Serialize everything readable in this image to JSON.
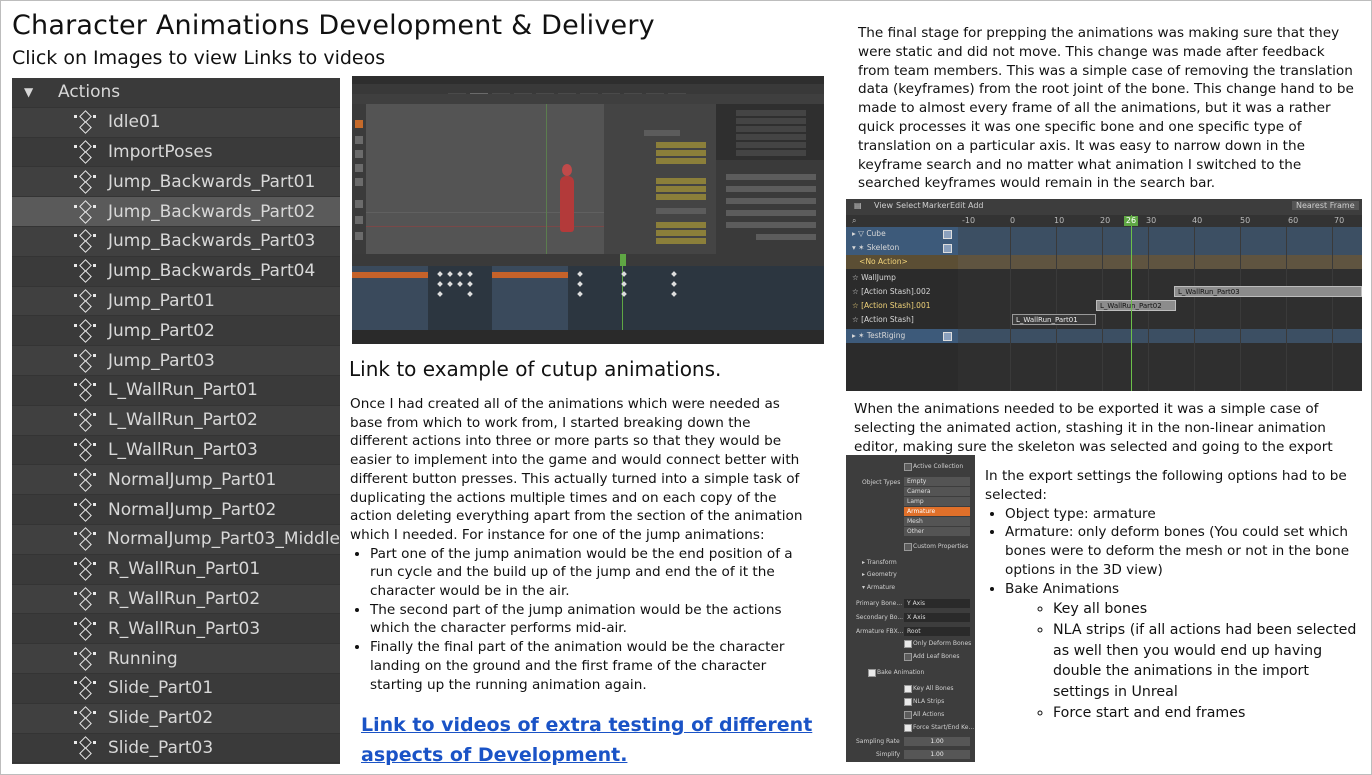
{
  "page": {
    "title": "Character Animations Development & Delivery",
    "subtitle": "Click on Images to view Links to videos"
  },
  "outliner": {
    "header": "Actions",
    "items": [
      "Idle01",
      "ImportPoses",
      "Jump_Backwards_Part01",
      "Jump_Backwards_Part02",
      "Jump_Backwards_Part03",
      "Jump_Backwards_Part04",
      "Jump_Part01",
      "Jump_Part02",
      "Jump_Part03",
      "L_WallRun_Part01",
      "L_WallRun_Part02",
      "L_WallRun_Part03",
      "NormalJump_Part01",
      "NormalJump_Part02",
      "NormalJump_Part03_Middle",
      "R_WallRun_Part01",
      "R_WallRun_Part02",
      "R_WallRun_Part03",
      "Running",
      "Slide_Part01",
      "Slide_Part02",
      "Slide_Part03"
    ],
    "selected_item": "Jump_Backwards_Part02"
  },
  "middle": {
    "cutup_link": "Link to example of cutup animations.",
    "intro": "Once I had created all of the animations which were needed as base from which to work from, I started breaking down the different actions into three or more parts so that they would be easier to implement into the game and would connect better with different button presses. This actually turned into a simple task of  duplicating the actions multiple times and on each copy of the action deleting everything apart from the section of the animation which I needed. For instance for one of the jump animations:",
    "bullets": [
      "Part one of the jump animation would be the end position of a run cycle and the build up of the jump and end the of it the character would be in the air.",
      "The second part of the jump animation would be the actions which the character performs mid-air.",
      "Finally the final part of the animation would be the character landing on the ground and the first frame of the character starting up the running animation again."
    ],
    "extra_link": "Link to videos of extra testing of different aspects of Development."
  },
  "right": {
    "final_stage": "The final stage for prepping the animations was making sure that they were static and did not move. This change was made after feedback from team members. This was a simple case of removing the translation data (keyframes) from the root joint of the bone. This change hand to be made to almost every frame of all the animations, but it was a rather quick processes it was one specific bone and one specific type of translation on a particular axis. It was easy to narrow down in the keyframe search and no matter what animation I switched to the searched keyframes would remain in the search bar.",
    "export_intro": "When the animations needed to be exported it was a simple case of selecting the animated action, stashing it in the non-linear animation editor, making sure the skeleton was selected and going to the export settings.",
    "export_lead": "In the export settings the following options had to be selected:",
    "export_options": [
      "Object type: armature",
      "Armature: only deform bones (You could set which bones were to deform the mesh or not in the bone options in the 3D view)",
      "Bake Animations"
    ],
    "bake_options": [
      "Key all bones",
      "NLA strips (if all actions had been selected as well then you would end up having double the animations in the import settings in Unreal",
      "Force start and end frames"
    ]
  },
  "nla_editor": {
    "header_menu": [
      "View",
      "Select",
      "Marker",
      "Edit",
      "Add"
    ],
    "snap_mode": "Nearest Frame",
    "ruler": [
      "-10",
      "0",
      "10",
      "20",
      "30",
      "40",
      "50",
      "60",
      "70"
    ],
    "current_frame": "26",
    "tracks": [
      "Cube",
      "Skeleton",
      "<No Action>",
      "WallJump",
      "[Action Stash].002",
      "[Action Stash].001",
      "[Action Stash]",
      "TestRiging"
    ],
    "strips": [
      "L_WallRun_Part03",
      "L_WallRun_Part02",
      "L_WallRun_Part01"
    ]
  },
  "export_panel": {
    "active_collection": "Active Collection",
    "object_types_label": "Object Types",
    "object_types": [
      "Empty",
      "Camera",
      "Lamp",
      "Armature",
      "Mesh",
      "Other"
    ],
    "selected_type": "Armature",
    "custom_properties": "Custom Properties",
    "sections": [
      "Transform",
      "Geometry",
      "Armature"
    ],
    "primary_bone_label": "Primary Bone...",
    "primary_bone_value": "Y Axis",
    "secondary_bone_label": "Secondary Bo...",
    "secondary_bone_value": "X Axis",
    "armature_fbx_label": "Armature FBX...",
    "armature_fbx_value": "Root",
    "only_deform": "Only Deform Bones",
    "add_leaf": "Add Leaf Bones",
    "bake_animation": "Bake Animation",
    "key_all_bones": "Key All Bones",
    "nla_strips": "NLA Strips",
    "all_actions": "All Actions",
    "force_start_end": "Force Start/End Ke...",
    "sampling_rate_label": "Sampling Rate",
    "sampling_rate": "1.00",
    "simplify_label": "Simplify",
    "simplify": "1.00"
  },
  "colors": {
    "link_blue": "#1a53c6",
    "outliner_bg": "#3a3a3a",
    "blender_orange": "#e0702a",
    "timeline_green": "#6cc04a"
  }
}
